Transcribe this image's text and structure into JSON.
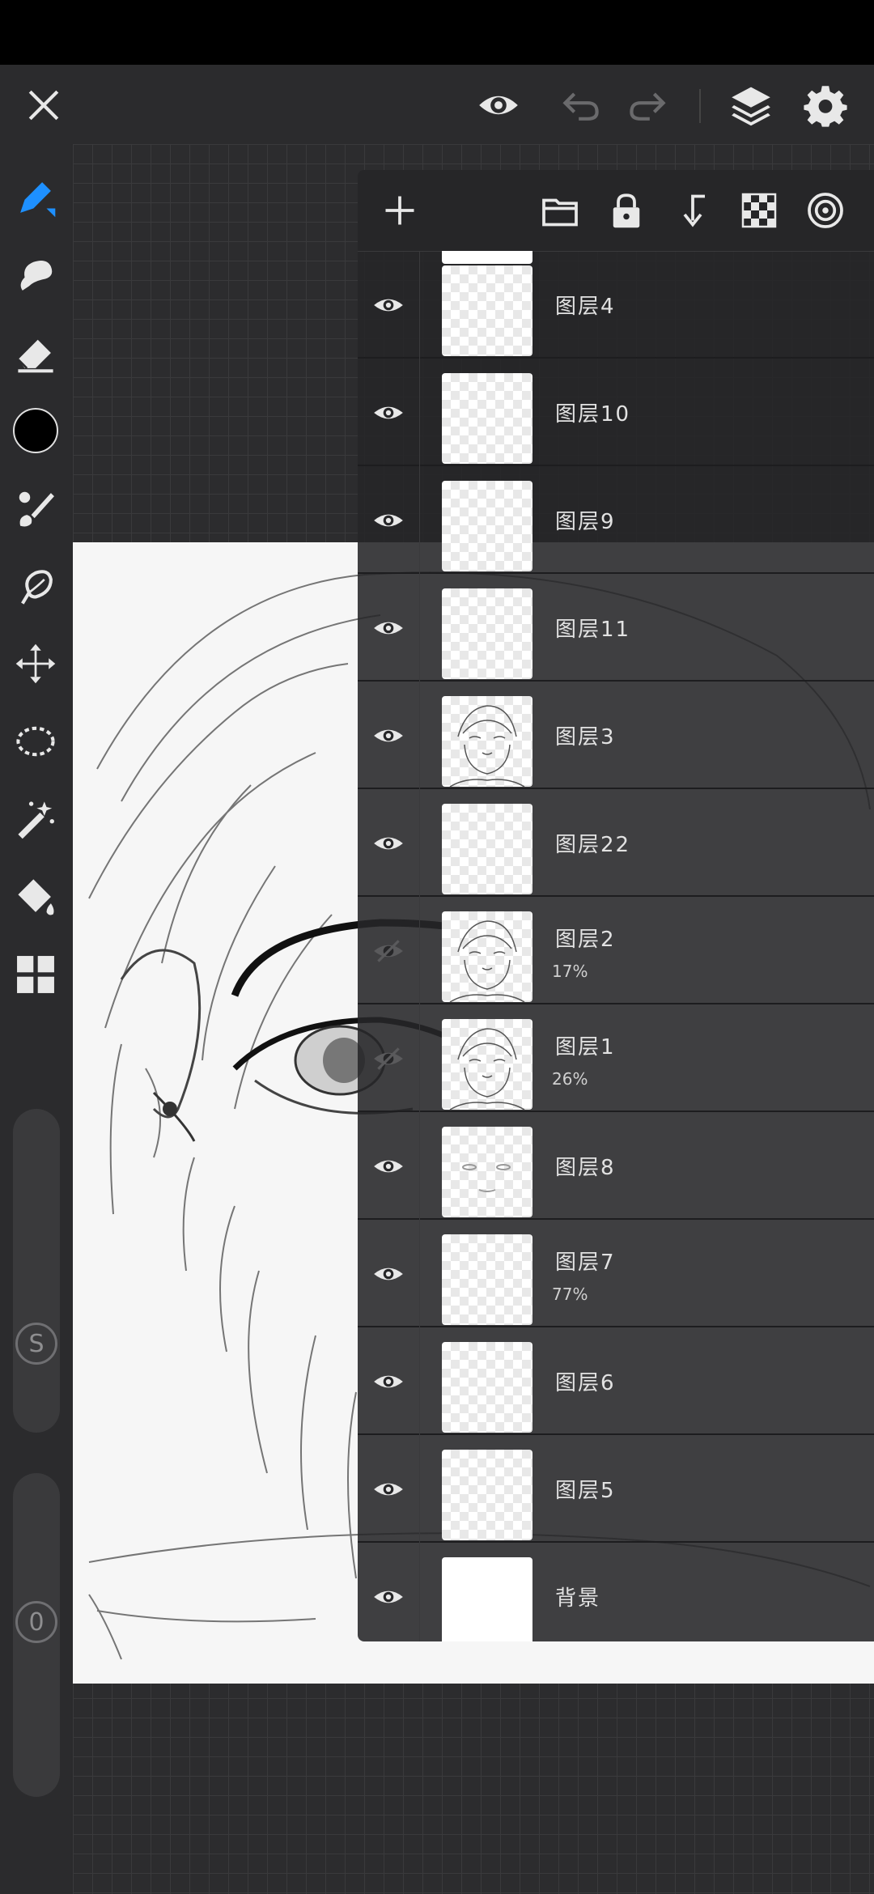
{
  "top_bar": {
    "icons": [
      "close-icon",
      "eye-icon",
      "undo-icon",
      "redo-icon",
      "layers-icon",
      "settings-icon"
    ]
  },
  "left_toolbar": {
    "tools": [
      "brush-icon",
      "smudge-icon",
      "eraser-icon",
      "color-swatch",
      "paint-brush-icon",
      "lasso-icon",
      "transform-icon",
      "selection-icon",
      "magic-wand-icon",
      "fill-bucket-icon",
      "gallery-icon"
    ],
    "color": "#000000",
    "size_slider_label": "S",
    "opacity_slider_label": "0"
  },
  "layer_panel": {
    "toolbar_icons": [
      "add-icon",
      "folder-icon",
      "lock-icon",
      "merge-down-icon",
      "checker-icon",
      "target-icon"
    ],
    "layers": [
      {
        "name": "图层4",
        "opacity": "",
        "visible": true,
        "thumb": "transparent"
      },
      {
        "name": "图层10",
        "opacity": "",
        "visible": true,
        "thumb": "transparent"
      },
      {
        "name": "图层9",
        "opacity": "",
        "visible": true,
        "thumb": "transparent"
      },
      {
        "name": "图层11",
        "opacity": "",
        "visible": true,
        "thumb": "transparent"
      },
      {
        "name": "图层3",
        "opacity": "",
        "visible": true,
        "thumb": "sketch"
      },
      {
        "name": "图层22",
        "opacity": "",
        "visible": true,
        "thumb": "transparent"
      },
      {
        "name": "图层2",
        "opacity": "17%",
        "visible": false,
        "thumb": "sketch"
      },
      {
        "name": "图层1",
        "opacity": "26%",
        "visible": false,
        "thumb": "sketch"
      },
      {
        "name": "图层8",
        "opacity": "",
        "visible": true,
        "thumb": "transparent"
      },
      {
        "name": "图层7",
        "opacity": "77%",
        "visible": true,
        "thumb": "transparent"
      },
      {
        "name": "图层6",
        "opacity": "",
        "visible": true,
        "thumb": "transparent"
      },
      {
        "name": "图层5",
        "opacity": "",
        "visible": true,
        "thumb": "transparent"
      },
      {
        "name": "背景",
        "opacity": "",
        "visible": true,
        "thumb": "white"
      }
    ]
  },
  "colors": {
    "accent": "#1e90ff",
    "panel_bg": "#262628",
    "toolbar_bg": "#2b2b2d"
  }
}
